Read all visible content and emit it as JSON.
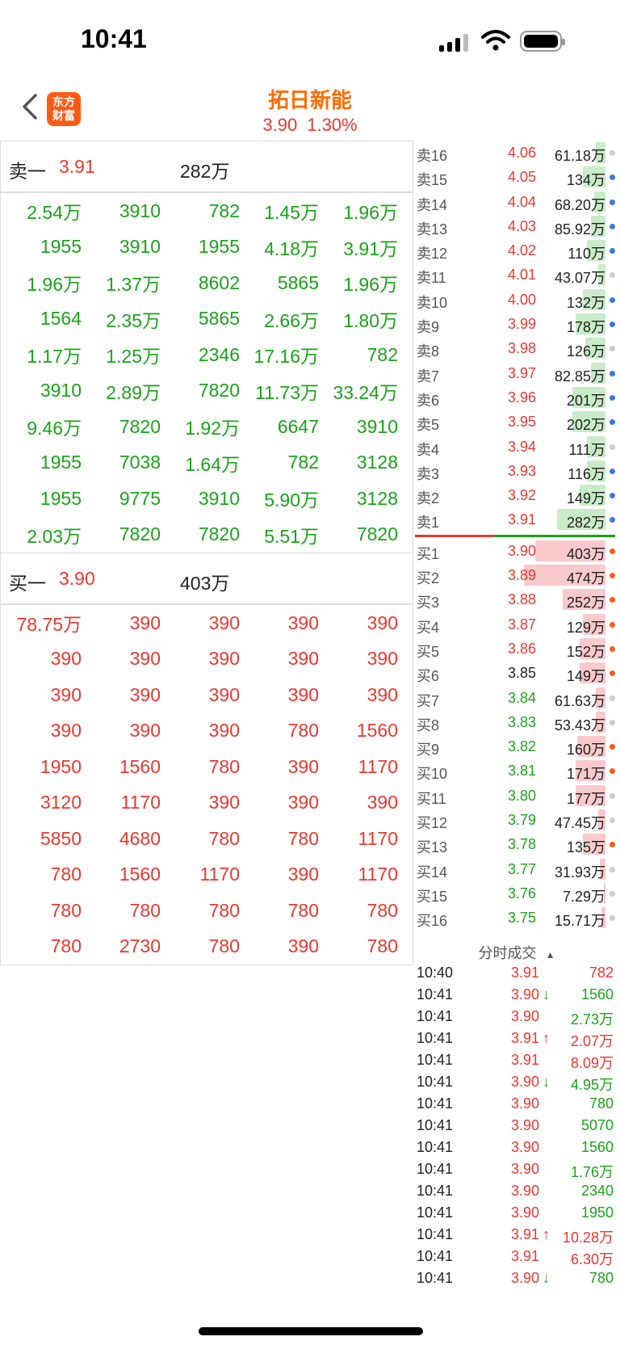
{
  "status_bar": {
    "time": "10:41"
  },
  "header": {
    "logo_line1": "东方",
    "logo_line2": "财富",
    "stock_name": "拓日新能",
    "price": "3.90",
    "change_pct": "1.30%"
  },
  "sell_section": {
    "label": "卖一",
    "price": "3.91",
    "volume": "282万",
    "rows": [
      [
        "2.54万",
        "3910",
        "782",
        "1.45万",
        "1.96万"
      ],
      [
        "1955",
        "3910",
        "1955",
        "4.18万",
        "3.91万"
      ],
      [
        "1.96万",
        "1.37万",
        "8602",
        "5865",
        "1.96万"
      ],
      [
        "1564",
        "2.35万",
        "5865",
        "2.66万",
        "1.80万"
      ],
      [
        "1.17万",
        "1.25万",
        "2346",
        "17.16万",
        "782"
      ],
      [
        "3910",
        "2.89万",
        "7820",
        "11.73万",
        "33.24万"
      ],
      [
        "9.46万",
        "7820",
        "1.92万",
        "6647",
        "3910"
      ],
      [
        "1955",
        "7038",
        "1.64万",
        "782",
        "3128"
      ],
      [
        "1955",
        "9775",
        "3910",
        "5.90万",
        "3128"
      ],
      [
        "2.03万",
        "7820",
        "7820",
        "5.51万",
        "7820"
      ]
    ]
  },
  "buy_section": {
    "label": "买一",
    "price": "3.90",
    "volume": "403万",
    "rows": [
      [
        "78.75万",
        "390",
        "390",
        "390",
        "390"
      ],
      [
        "390",
        "390",
        "390",
        "390",
        "390"
      ],
      [
        "390",
        "390",
        "390",
        "390",
        "390"
      ],
      [
        "390",
        "390",
        "390",
        "780",
        "1560"
      ],
      [
        "1950",
        "1560",
        "780",
        "390",
        "1170"
      ],
      [
        "3120",
        "1170",
        "390",
        "390",
        "390"
      ],
      [
        "5850",
        "4680",
        "780",
        "780",
        "1170"
      ],
      [
        "780",
        "1560",
        "1170",
        "390",
        "1170"
      ],
      [
        "780",
        "780",
        "780",
        "780",
        "780"
      ],
      [
        "780",
        "2730",
        "780",
        "390",
        "780"
      ]
    ]
  },
  "asks": [
    {
      "label": "卖16",
      "price": "4.06",
      "volume": "61.18万",
      "fill": 0.05,
      "dot": "#cccccc"
    },
    {
      "label": "卖15",
      "price": "4.05",
      "volume": "134万",
      "fill": 0.12,
      "dot": "#3a7bd5"
    },
    {
      "label": "卖14",
      "price": "4.04",
      "volume": "68.20万",
      "fill": 0.06,
      "dot": "#3a7bd5"
    },
    {
      "label": "卖13",
      "price": "4.03",
      "volume": "85.92万",
      "fill": 0.08,
      "dot": "#3a7bd5"
    },
    {
      "label": "卖12",
      "price": "4.02",
      "volume": "110万",
      "fill": 0.1,
      "dot": "#3a7bd5"
    },
    {
      "label": "卖11",
      "price": "4.01",
      "volume": "43.07万",
      "fill": 0.04,
      "dot": "#cccccc"
    },
    {
      "label": "卖10",
      "price": "4.00",
      "volume": "132万",
      "fill": 0.12,
      "dot": "#3a7bd5"
    },
    {
      "label": "卖9",
      "price": "3.99",
      "volume": "178万",
      "fill": 0.16,
      "dot": "#3a7bd5"
    },
    {
      "label": "卖8",
      "price": "3.98",
      "volume": "126万",
      "fill": 0.11,
      "dot": "#cccccc"
    },
    {
      "label": "卖7",
      "price": "3.97",
      "volume": "82.85万",
      "fill": 0.08,
      "dot": "#3a7bd5"
    },
    {
      "label": "卖6",
      "price": "3.96",
      "volume": "201万",
      "fill": 0.18,
      "dot": "#3a7bd5"
    },
    {
      "label": "卖5",
      "price": "3.95",
      "volume": "202万",
      "fill": 0.18,
      "dot": "#3a7bd5"
    },
    {
      "label": "卖4",
      "price": "3.94",
      "volume": "111万",
      "fill": 0.1,
      "dot": "#cccccc"
    },
    {
      "label": "卖3",
      "price": "3.93",
      "volume": "116万",
      "fill": 0.1,
      "dot": "#3a7bd5"
    },
    {
      "label": "卖2",
      "price": "3.92",
      "volume": "149万",
      "fill": 0.14,
      "dot": "#3a7bd5"
    },
    {
      "label": "卖1",
      "price": "3.91",
      "volume": "282万",
      "fill": 0.26,
      "dot": "#3a7bd5"
    }
  ],
  "bids": [
    {
      "label": "买1",
      "price": "3.90",
      "volume": "403万",
      "fill": 0.38,
      "dot": "#ff5a14",
      "pcolor": "red"
    },
    {
      "label": "买2",
      "price": "3.89",
      "volume": "474万",
      "fill": 0.44,
      "dot": "#ff5a14",
      "pcolor": "red"
    },
    {
      "label": "买3",
      "price": "3.88",
      "volume": "252万",
      "fill": 0.23,
      "dot": "#ff5a14",
      "pcolor": "red"
    },
    {
      "label": "买4",
      "price": "3.87",
      "volume": "129万",
      "fill": 0.12,
      "dot": "#ff5a14",
      "pcolor": "red"
    },
    {
      "label": "买5",
      "price": "3.86",
      "volume": "152万",
      "fill": 0.14,
      "dot": "#ff5a14",
      "pcolor": "red"
    },
    {
      "label": "买6",
      "price": "3.85",
      "volume": "149万",
      "fill": 0.14,
      "dot": "#ff5a14",
      "pcolor": "dark"
    },
    {
      "label": "买7",
      "price": "3.84",
      "volume": "61.63万",
      "fill": 0.05,
      "dot": "#cccccc",
      "pcolor": "green"
    },
    {
      "label": "买8",
      "price": "3.83",
      "volume": "53.43万",
      "fill": 0.05,
      "dot": "#cccccc",
      "pcolor": "green"
    },
    {
      "label": "买9",
      "price": "3.82",
      "volume": "160万",
      "fill": 0.15,
      "dot": "#ff5a14",
      "pcolor": "green"
    },
    {
      "label": "买10",
      "price": "3.81",
      "volume": "171万",
      "fill": 0.16,
      "dot": "#ff5a14",
      "pcolor": "green"
    },
    {
      "label": "买11",
      "price": "3.80",
      "volume": "177万",
      "fill": 0.16,
      "dot": "#cccccc",
      "pcolor": "green"
    },
    {
      "label": "买12",
      "price": "3.79",
      "volume": "47.45万",
      "fill": 0.04,
      "dot": "#cccccc",
      "pcolor": "green"
    },
    {
      "label": "买13",
      "price": "3.78",
      "volume": "135万",
      "fill": 0.12,
      "dot": "#ff5a14",
      "pcolor": "green"
    },
    {
      "label": "买14",
      "price": "3.77",
      "volume": "31.93万",
      "fill": 0.03,
      "dot": "#cccccc",
      "pcolor": "green"
    },
    {
      "label": "买15",
      "price": "3.76",
      "volume": "7.29万",
      "fill": 0.01,
      "dot": "#cccccc",
      "pcolor": "green"
    },
    {
      "label": "买16",
      "price": "3.75",
      "volume": "15.71万",
      "fill": 0.02,
      "dot": "#cccccc",
      "pcolor": "green"
    }
  ],
  "trades_title": "分时成交",
  "trades": [
    {
      "time": "10:40",
      "price": "3.91",
      "arrow": "",
      "vol": "782",
      "vcolor": "red"
    },
    {
      "time": "10:41",
      "price": "3.90",
      "arrow": "down",
      "vol": "1560",
      "vcolor": "green"
    },
    {
      "time": "10:41",
      "price": "3.90",
      "arrow": "",
      "vol": "2.73万",
      "vcolor": "green"
    },
    {
      "time": "10:41",
      "price": "3.91",
      "arrow": "up",
      "vol": "2.07万",
      "vcolor": "red"
    },
    {
      "time": "10:41",
      "price": "3.91",
      "arrow": "",
      "vol": "8.09万",
      "vcolor": "red"
    },
    {
      "time": "10:41",
      "price": "3.90",
      "arrow": "down",
      "vol": "4.95万",
      "vcolor": "green"
    },
    {
      "time": "10:41",
      "price": "3.90",
      "arrow": "",
      "vol": "780",
      "vcolor": "green"
    },
    {
      "time": "10:41",
      "price": "3.90",
      "arrow": "",
      "vol": "5070",
      "vcolor": "green"
    },
    {
      "time": "10:41",
      "price": "3.90",
      "arrow": "",
      "vol": "1560",
      "vcolor": "green"
    },
    {
      "time": "10:41",
      "price": "3.90",
      "arrow": "",
      "vol": "1.76万",
      "vcolor": "green"
    },
    {
      "time": "10:41",
      "price": "3.90",
      "arrow": "",
      "vol": "2340",
      "vcolor": "green"
    },
    {
      "time": "10:41",
      "price": "3.90",
      "arrow": "",
      "vol": "1950",
      "vcolor": "green"
    },
    {
      "time": "10:41",
      "price": "3.91",
      "arrow": "up",
      "vol": "10.28万",
      "vcolor": "red"
    },
    {
      "time": "10:41",
      "price": "3.91",
      "arrow": "",
      "vol": "6.30万",
      "vcolor": "red"
    },
    {
      "time": "10:41",
      "price": "3.90",
      "arrow": "down",
      "vol": "780",
      "vcolor": "green"
    }
  ]
}
